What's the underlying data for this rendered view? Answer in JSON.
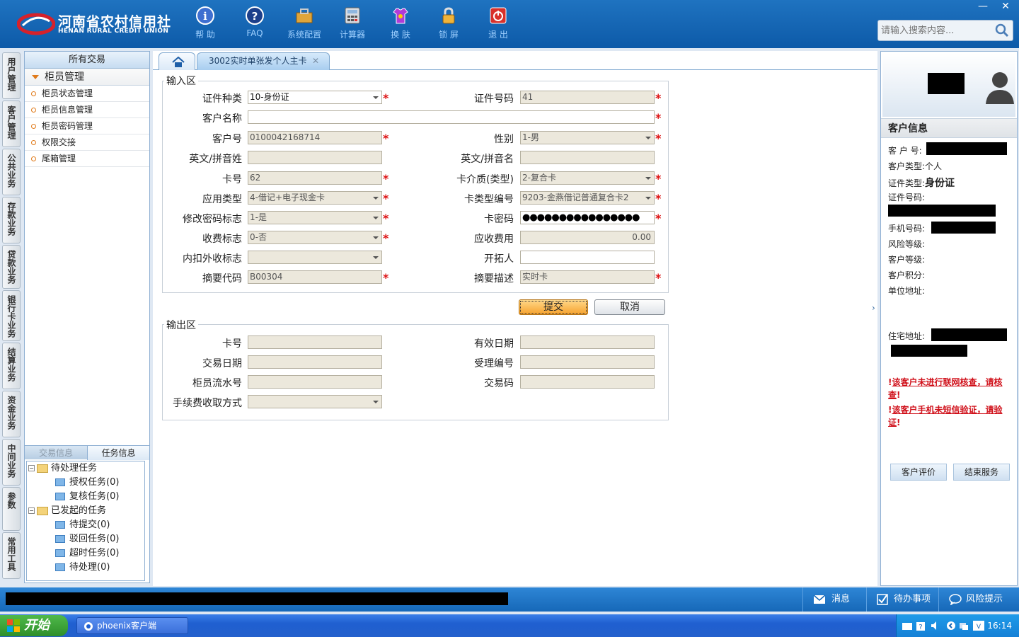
{
  "header": {
    "logo_cn": "河南省农村信用社",
    "logo_en": "HENAN RURAL CREDIT UNION",
    "tools": [
      {
        "label": "帮 助",
        "icon": "info-icon"
      },
      {
        "label": "FAQ",
        "icon": "question-icon"
      },
      {
        "label": "系统配置",
        "icon": "toolbox-icon"
      },
      {
        "label": "计算器",
        "icon": "calculator-icon"
      },
      {
        "label": "换 肤",
        "icon": "shirt-icon"
      },
      {
        "label": "锁 屏",
        "icon": "lock-icon"
      },
      {
        "label": "退 出",
        "icon": "power-icon"
      }
    ],
    "search_placeholder": "请输入搜索内容..."
  },
  "vtabs": [
    "用户管理",
    "客户管理",
    "公共业务",
    "存款业务",
    "贷款业务",
    "银行卡业务",
    "结算业务",
    "资金业务",
    "中间业务",
    "参数",
    "常用工具"
  ],
  "left": {
    "title": "所有交易",
    "group": "柜员管理",
    "items": [
      "柜员状态管理",
      "柜员信息管理",
      "柜员密码管理",
      "权限交接",
      "尾箱管理"
    ],
    "tabs": [
      "交易信息",
      "任务信息"
    ],
    "tree": {
      "pending": "待处理任务",
      "auth": "授权任务(0)",
      "review": "复核任务(0)",
      "initiated": "已发起的任务",
      "to_submit": "待提交(0)",
      "rejected": "驳回任务(0)",
      "timeout": "超时任务(0)",
      "to_handle": "待处理(0)"
    }
  },
  "main": {
    "tab_title": "3002实时单张发个人主卡",
    "input_title": "输入区",
    "output_title": "输出区",
    "fields": {
      "id_type_label": "证件种类",
      "id_type": "10-身份证",
      "id_no_label": "证件号码",
      "id_no": "41",
      "cust_name_label": "客户名称",
      "cust_no_label": "客户号",
      "cust_no": "0100042168714",
      "gender_label": "性别",
      "gender": "1-男",
      "en_last_label": "英文/拼音姓",
      "en_first_label": "英文/拼音名",
      "card_no_label": "卡号",
      "card_no": "62",
      "card_medium_label": "卡介质(类型)",
      "card_medium": "2-复合卡",
      "app_type_label": "应用类型",
      "app_type": "4-借记+电子现金卡",
      "card_type_no_label": "卡类型编号",
      "card_type_no": "9203-金燕借记普通复合卡2",
      "pwd_flag_label": "修改密码标志",
      "pwd_flag": "1-是",
      "card_pwd_label": "卡密码",
      "card_pwd": "●●●●●●●●●●●●●●●●",
      "fee_flag_label": "收费标志",
      "fee_flag": "0-否",
      "fee_due_label": "应收费用",
      "fee_due": "0.00",
      "deduct_label": "内扣外收标志",
      "developer_label": "开拓人",
      "summary_code_label": "摘要代码",
      "summary_code": "B00304",
      "summary_desc_label": "摘要描述",
      "summary_desc": "实时卡"
    },
    "submit": "提交",
    "cancel": "取消",
    "out": {
      "card_no_label": "卡号",
      "valid_label": "有效日期",
      "date_label": "交易日期",
      "accept_label": "受理编号",
      "serial_label": "柜员流水号",
      "code_label": "交易码",
      "fee_mode_label": "手续费收取方式"
    }
  },
  "right": {
    "title": "客户信息",
    "cust_no_label": "客 户 号:",
    "cust_type_label": "客户类型:",
    "cust_type": "个人",
    "id_type_label": "证件类型:",
    "id_type": "身份证",
    "id_no_label": "证件号码:",
    "phone_label": "手机号码:",
    "risk_label": "风险等级:",
    "level_label": "客户等级:",
    "points_label": "客户积分:",
    "work_addr_label": "单位地址:",
    "home_addr_label": "住宅地址:",
    "warn1": "该客户未进行联网核查，请核查",
    "warn2": "该客户手机未短信验证，请验证",
    "btn_eval": "客户评价",
    "btn_end": "结束服务"
  },
  "statusbar": {
    "msg": "消息",
    "todo": "待办事项",
    "risk": "风险提示"
  },
  "taskbar": {
    "start": "开始",
    "task": "phoenix客户端",
    "time": "16:14"
  }
}
